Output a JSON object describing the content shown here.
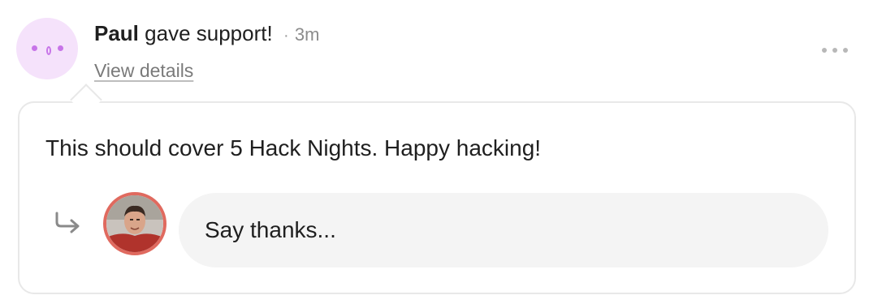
{
  "activity": {
    "user_name": "Paul",
    "action_text": " gave support!",
    "separator": "·",
    "time_ago": "3m",
    "view_details_label": "View details",
    "avatar_icon": "smiley-face-icon",
    "more_icon": "more-options-icon"
  },
  "card": {
    "message": "This should cover 5 Hack Nights. Happy hacking!"
  },
  "reply": {
    "arrow_icon": "reply-arrow-icon",
    "avatar_icon": "user-avatar-photo",
    "placeholder": "Say thanks..."
  },
  "colors": {
    "avatar_bg": "#f5e2fb",
    "avatar_accent": "#c774e8",
    "user_avatar_ring": "#e06a5f",
    "input_bg": "#f4f4f4",
    "card_border": "#e8e8e8"
  }
}
